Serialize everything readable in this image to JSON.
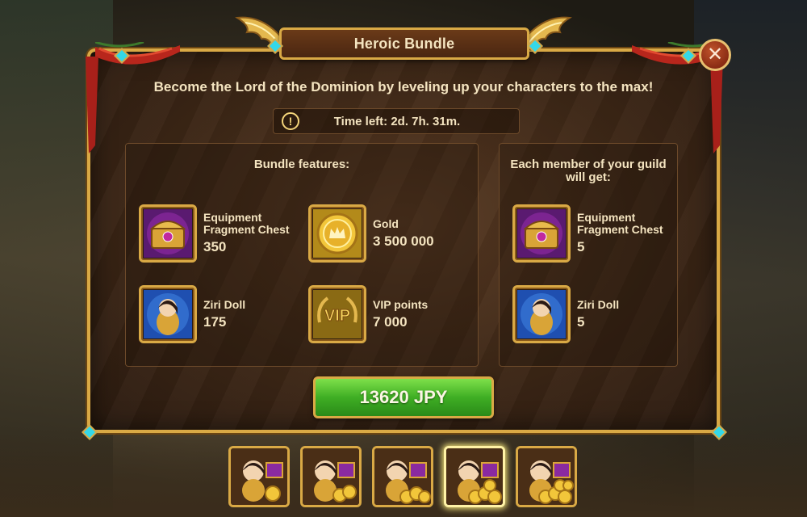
{
  "header": {
    "title": "Heroic Bundle"
  },
  "subtitle": "Become the Lord of the Dominion by leveling up your characters to the max!",
  "timer": {
    "icon": "exclamation-icon",
    "text": "Time left: 2d. 7h. 31m."
  },
  "features": {
    "title": "Bundle features:",
    "items": [
      {
        "name": "Equipment Fragment Chest",
        "value": "350",
        "icon": "purple-chest-icon"
      },
      {
        "name": "Gold",
        "value": "3 500 000",
        "icon": "gold-coin-icon"
      },
      {
        "name": "Ziri Doll",
        "value": "175",
        "icon": "ziri-doll-icon"
      },
      {
        "name": "VIP points",
        "value": "7 000",
        "icon": "vip-badge-icon"
      }
    ]
  },
  "guild": {
    "title": "Each member of your guild will get:",
    "items": [
      {
        "name": "Equipment Fragment Chest",
        "value": "5",
        "icon": "purple-chest-icon"
      },
      {
        "name": "Ziri Doll",
        "value": "5",
        "icon": "ziri-doll-icon"
      }
    ]
  },
  "buy_button": {
    "label": "13620 JPY"
  },
  "bundle_tabs": {
    "count": 5,
    "selected_index": 3
  },
  "colors": {
    "gold_border": "#d9a945",
    "buy_green": "#3fae24",
    "panel_brown": "#3d2716",
    "text_cream": "#f4e4c0"
  }
}
